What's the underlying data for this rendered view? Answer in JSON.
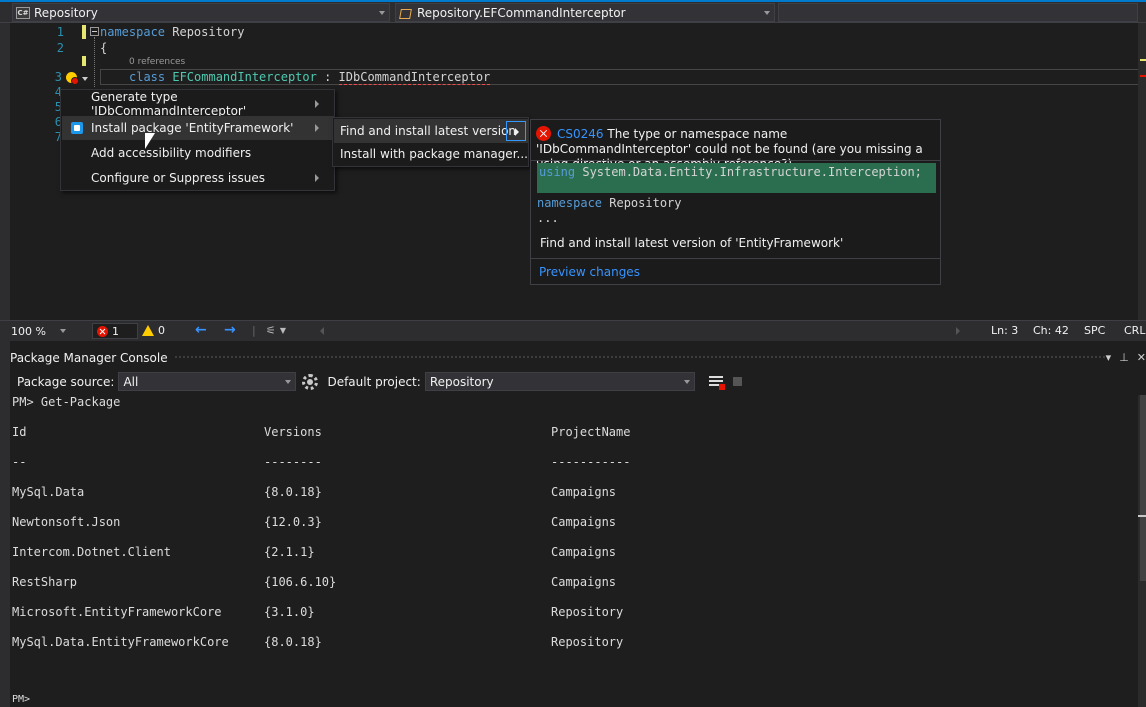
{
  "navbar": {
    "project_combo": "Repository",
    "project_icon_text": "C#",
    "type_combo": "Repository.EFCommandInterceptor"
  },
  "editor": {
    "line_numbers": [
      "1",
      "2",
      "3",
      "4",
      "5",
      "6",
      "7"
    ],
    "line1_kw": "namespace",
    "line1_name": " Repository",
    "line2": "{",
    "codelens": "0 references",
    "line3_kw": "class",
    "line3_type": "EFCommandInterceptor",
    "line3_colon": " : ",
    "line3_iface": "IDbCommandInterceptor"
  },
  "quick_actions": {
    "items": [
      {
        "label": "Generate type 'IDbCommandInterceptor'",
        "has_submenu": true
      },
      {
        "label": "Install package 'EntityFramework'",
        "has_submenu": true
      },
      {
        "label": "Add accessibility modifiers",
        "has_submenu": false
      },
      {
        "label": "Configure or Suppress issues",
        "has_submenu": true
      }
    ],
    "submenu": [
      {
        "label": "Find and install latest version"
      },
      {
        "label": "Install with package manager..."
      }
    ]
  },
  "preview": {
    "error_code": "CS0246",
    "error_message": " The type or namespace name 'IDbCommandInterceptor' could not be found (are you missing a using directive or an assembly reference?)",
    "added_line_kw": "using",
    "added_line_rest": " System.Data.Entity.Infrastructure.Interception;",
    "ns_kw": "namespace",
    "ns_name": " Repository",
    "ellipsis": "...",
    "description": "Find and install latest version of 'EntityFramework'",
    "link": "Preview changes"
  },
  "status": {
    "zoom": "100 %",
    "errors": "1",
    "warnings": "0",
    "line": "Ln: 3",
    "col": "Ch: 42",
    "whitespace": "SPC",
    "eol": "CRLF"
  },
  "pmc": {
    "title": "Package Manager Console",
    "source_label": "Package source:",
    "source_value": "All",
    "project_label": "Default project:",
    "project_value": "Repository",
    "prompt_cmd": "PM> Get-Package",
    "headers": [
      "Id",
      "Versions",
      "ProjectName"
    ],
    "separators": [
      "--",
      "--------",
      "-----------"
    ],
    "rows": [
      [
        "MySql.Data",
        "{8.0.18}",
        "Campaigns"
      ],
      [
        "Newtonsoft.Json",
        "{12.0.3}",
        "Campaigns"
      ],
      [
        "Intercom.Dotnet.Client",
        "{2.1.1}",
        "Campaigns"
      ],
      [
        "RestSharp",
        "{106.6.10}",
        "Campaigns"
      ],
      [
        "Microsoft.EntityFrameworkCore",
        "{3.1.0}",
        "Repository"
      ],
      [
        "MySql.Data.EntityFrameworkCore",
        "{8.0.18}",
        "Repository"
      ]
    ],
    "final_prompt": "PM>"
  }
}
